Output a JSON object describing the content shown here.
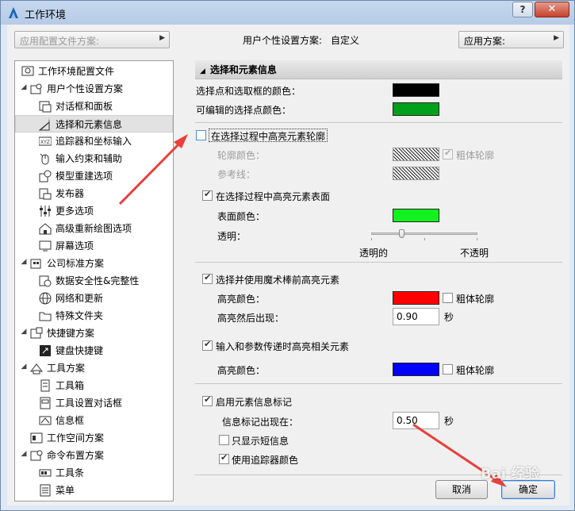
{
  "window": {
    "title": "工作环境",
    "help_label": "?",
    "close_label": "✕"
  },
  "header": {
    "profile_dropdown_placeholder": "应用配置文件方案:",
    "profile_label": "用户个性设置方案:",
    "profile_value": "自定义",
    "apply_scheme_label": "应用方案:"
  },
  "tree": {
    "items": [
      {
        "label": "工作环境配置文件",
        "icon": "profile-icon"
      },
      {
        "label": "用户个性设置方案",
        "icon": "user-settings-icon"
      },
      {
        "label": "对话框和面板",
        "icon": "dialog-icon"
      },
      {
        "label": "选择和元素信息",
        "icon": "selection-info-icon"
      },
      {
        "label": "追踪器和坐标输入",
        "icon": "tracker-icon"
      },
      {
        "label": "输入约束和辅助",
        "icon": "mouse-icon"
      },
      {
        "label": "模型重建选项",
        "icon": "model-rebuild-icon"
      },
      {
        "label": "发布器",
        "icon": "publisher-icon"
      },
      {
        "label": "更多选项",
        "icon": "sliders-icon"
      },
      {
        "label": "高级重新绘图选项",
        "icon": "redraw-icon"
      },
      {
        "label": "屏幕选项",
        "icon": "screen-icon"
      },
      {
        "label": "公司标准方案",
        "icon": "company-icon"
      },
      {
        "label": "数据安全性&完整性",
        "icon": "data-safety-icon"
      },
      {
        "label": "网络和更新",
        "icon": "network-icon"
      },
      {
        "label": "特殊文件夹",
        "icon": "folder-icon"
      },
      {
        "label": "快捷键方案",
        "icon": "shortcut-scheme-icon"
      },
      {
        "label": "键盘快捷键",
        "icon": "keyboard-icon"
      },
      {
        "label": "工具方案",
        "icon": "tool-scheme-icon"
      },
      {
        "label": "工具箱",
        "icon": "toolbox-icon"
      },
      {
        "label": "工具设置对话框",
        "icon": "tool-settings-icon"
      },
      {
        "label": "信息框",
        "icon": "infobox-icon"
      },
      {
        "label": "工作空间方案",
        "icon": "workspace-icon"
      },
      {
        "label": "命令布置方案",
        "icon": "command-layout-icon"
      },
      {
        "label": "工具条",
        "icon": "toolbar-icon"
      },
      {
        "label": "菜单",
        "icon": "menu-icon"
      }
    ]
  },
  "panel": {
    "section_title": "选择和元素信息",
    "selection_color_label": "选择点和选取框的颜色：",
    "selection_color": "#000000",
    "editable_point_label": "可编辑的选择点颜色：",
    "editable_point_color": "#00a01a",
    "highlight_outline_label": "在选择过程中高亮元素轮廓",
    "highlight_outline_checked": false,
    "outline_color_label": "轮廓颜色：",
    "bold_outline_label": "粗体轮廓",
    "reference_line_label": "参考线：",
    "highlight_surface_label": "在选择过程中高亮元素表面",
    "highlight_surface_checked": true,
    "surface_color_label": "表面颜色：",
    "surface_color": "#12f21e",
    "transparency_label": "透明：",
    "transparency_value": 0.28,
    "transparent_label": "透明的",
    "opaque_label": "不透明",
    "magic_wand_label": "选择并使用魔术棒前高亮元素",
    "magic_wand_checked": true,
    "highlight_color_label": "高亮颜色：",
    "magic_wand_color": "#ff0000",
    "magic_bold_label": "粗体轮廓",
    "highlight_delay_label": "高亮然后出现：",
    "highlight_delay_value": "0.90",
    "seconds_label": "秒",
    "param_highlight_label": "输入和参数传递时高亮相关元素",
    "param_highlight_checked": true,
    "param_color_label": "高亮颜色：",
    "param_color": "#0000ff",
    "param_bold_label": "粗体轮廓",
    "info_tag_label": "启用元素信息标记",
    "info_tag_checked": true,
    "info_tag_delay_label": "信息标记出现在：",
    "info_tag_delay_value": "0.50",
    "info_tag_seconds_label": "秒",
    "short_info_label": "只显示短信息",
    "short_info_checked": false,
    "tracker_color_label": "使用追踪器颜色",
    "tracker_color_checked": true
  },
  "footer": {
    "cancel_label": "取消",
    "ok_label": "确定"
  },
  "watermark": "Bai 经验",
  "accent_color": "#e8403a"
}
